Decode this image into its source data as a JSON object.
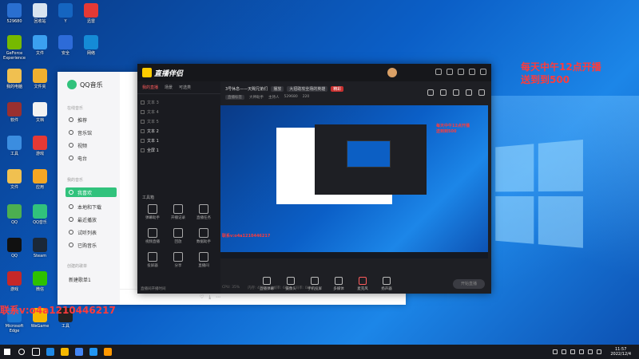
{
  "desktop": {
    "overlay_text": [
      "每天中午12点开播",
      "送到到500"
    ],
    "contact_text": "联系v:o4a1210446217",
    "icons": [
      {
        "label": "529680",
        "color": "#2a6fd0"
      },
      {
        "label": "回收站",
        "color": "#d8e4f0"
      },
      {
        "label": "Y",
        "color": "#1565c0"
      },
      {
        "label": "迅雷",
        "color": "#e53935"
      },
      {
        "label": "GeForce Experience",
        "color": "#76b900"
      },
      {
        "label": "文件",
        "color": "#3ba0f0"
      },
      {
        "label": "安全",
        "color": "#2d6bd8"
      },
      {
        "label": "网络",
        "color": "#158bd6"
      },
      {
        "label": "我的电脑",
        "color": "#f0c050"
      },
      {
        "label": "文件夹",
        "color": "#f0b030"
      },
      {
        "label": "软件",
        "color": "#9a3030"
      },
      {
        "label": "文档",
        "color": "#f2f2f2"
      },
      {
        "label": "工具",
        "color": "#3b8de0"
      },
      {
        "label": "游戏",
        "color": "#e53935"
      },
      {
        "label": "文件",
        "color": "#f0c050"
      },
      {
        "label": "应用",
        "color": "#f5a623"
      },
      {
        "label": "QQ",
        "color": "#4caf50"
      },
      {
        "label": "QQ音乐",
        "color": "#31c27c"
      },
      {
        "label": "QQ",
        "color": "#111111"
      },
      {
        "label": "Steam",
        "color": "#1b2838"
      },
      {
        "label": "游戏",
        "color": "#c62828"
      },
      {
        "label": "微信",
        "color": "#2dc100"
      },
      {
        "label": "Microsoft Edge",
        "color": "#1976d2"
      },
      {
        "label": "WeGame",
        "color": "#f5b800"
      },
      {
        "label": "工具",
        "color": "#222222"
      }
    ]
  },
  "qqmusic": {
    "logo": "QQ音乐",
    "section_online": "在线音乐",
    "online_items": [
      "推荐",
      "音乐馆",
      "视频",
      "电台"
    ],
    "section_mine": "我的音乐",
    "mine_items": [
      "我喜欢",
      "本地和下载",
      "最近播放",
      "试听列表",
      "已购音乐"
    ],
    "section_created": "创建的歌单",
    "created_items": [
      "新建歌单1"
    ]
  },
  "stream": {
    "app_name": "直播伴侣",
    "left_tabs": [
      "我的直播",
      "场景",
      "可选类"
    ],
    "scenes": [
      "文本 3",
      "文本 4",
      "文本 5",
      "文本 2",
      "文本 1",
      "全屏 1"
    ],
    "tools_title": "工具箱",
    "tools": [
      "弹幕助手",
      "开播记录",
      "直播任务",
      "视频直播",
      "回放",
      "数据助手",
      "投屏器",
      "分享",
      "直播间"
    ],
    "left_footer": "直播间开播时间",
    "title": "3号休息——天赐兄弟们",
    "tags": [
      "播放",
      "大招助攻全场的英雄",
      "精彩"
    ],
    "room_info": [
      "直播标签",
      "大神助手",
      "主持人",
      "529680",
      "220"
    ],
    "controls": [
      "直播弹幕",
      "摄像头",
      "手机投屏",
      "多媒体",
      "麦克风",
      "扬声器"
    ],
    "go_live": "开始直播",
    "stats": [
      "CPU: 35%",
      "内存: 42%",
      "帧率: 60",
      "码率: 0kb/s"
    ]
  },
  "taskbar": {
    "time": "11:57",
    "date": "2022/12/4",
    "apps": [
      {
        "name": "edge",
        "color": "#1e88e5"
      },
      {
        "name": "file-explorer",
        "color": "#f5b800"
      },
      {
        "name": "browser",
        "color": "#4285f4"
      },
      {
        "name": "app",
        "color": "#2196f3"
      },
      {
        "name": "live",
        "color": "#ff9800"
      }
    ]
  }
}
